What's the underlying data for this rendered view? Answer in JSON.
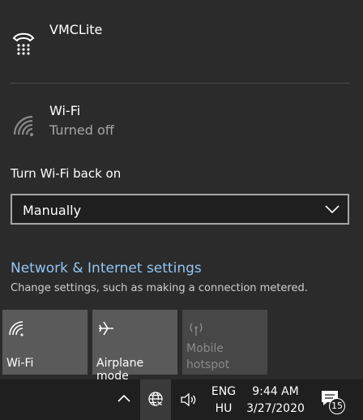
{
  "connections": {
    "vmc": {
      "name": "VMCLite",
      "icon": "phone-dialup-icon"
    },
    "wifi": {
      "name": "Wi-Fi",
      "status": "Turned off",
      "icon": "wifi-off-icon"
    }
  },
  "turn_on": {
    "label": "Turn Wi-Fi back on",
    "selected": "Manually"
  },
  "settings": {
    "link": "Network & Internet settings",
    "description": "Change settings, such as making a connection metered."
  },
  "tiles": [
    {
      "label": "Wi-Fi",
      "icon": "wifi-icon",
      "enabled": true
    },
    {
      "label": "Airplane mode",
      "icon": "airplane-icon",
      "enabled": true
    },
    {
      "label": "Mobile hotspot",
      "icon": "hotspot-icon",
      "enabled": false
    }
  ],
  "taskbar": {
    "lang_top": "ENG",
    "lang_bottom": "HU",
    "time": "9:44 AM",
    "date": "3/27/2020",
    "notifications": "15"
  },
  "colors": {
    "accent_link": "#93c6f2",
    "flyout_bg": "#2b2b2b",
    "tile_bg": "#5a5a5a"
  }
}
